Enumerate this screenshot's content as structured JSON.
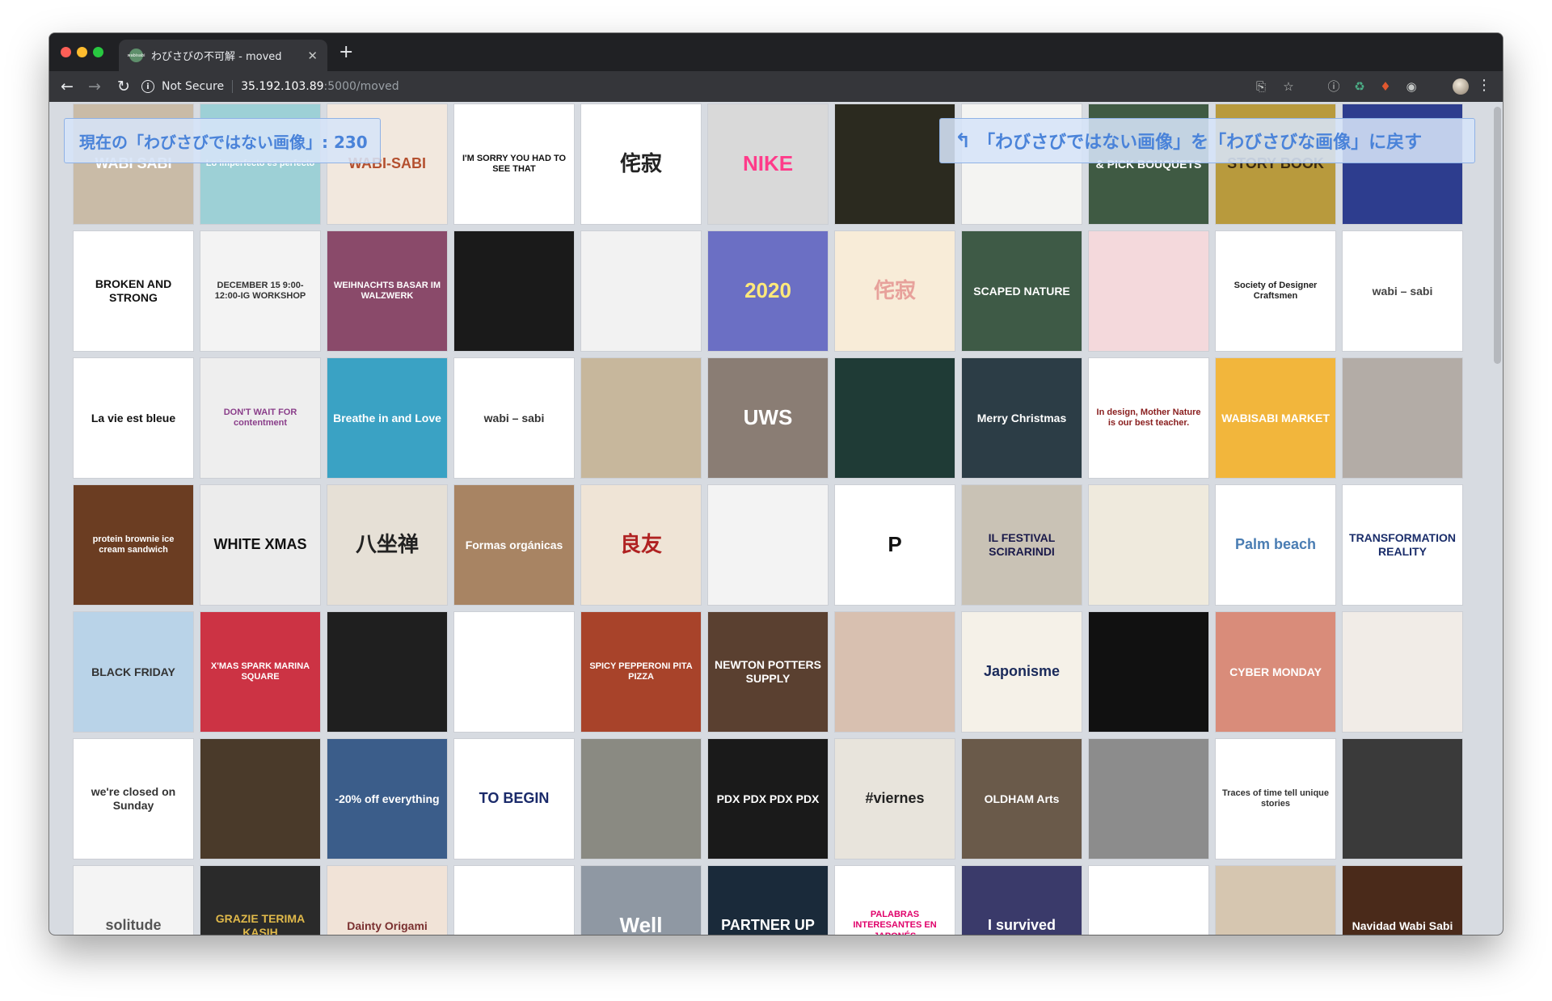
{
  "browser": {
    "tab_title": "わびさびの不可解 - moved",
    "tab_favicon_text": "wabisabi",
    "address": {
      "security": "Not Secure",
      "host": "35.192.103.89",
      "path": ":5000/moved"
    }
  },
  "page": {
    "count_label": "現在の「わびさびではない画像」: 230",
    "return_button_label": "「わびさびではない画像」を「わびさびな画像」に戻す"
  },
  "tiles": [
    [
      {
        "text": "WABI SABI",
        "bg": "#c9bba7",
        "fg": "#ffffff"
      },
      {
        "text": "Lo imperfecto es perfecto",
        "bg": "#9dd0d6",
        "fg": "#ffffff"
      },
      {
        "text": "WABI-SABI",
        "bg": "#f2e8de",
        "fg": "#b4502f"
      },
      {
        "text": "I'M SORRY YOU HAD TO SEE THAT",
        "bg": "#ffffff",
        "fg": "#111111"
      },
      {
        "text": "侘寂",
        "bg": "#ffffff",
        "fg": "#222222"
      },
      {
        "text": "NIKE",
        "bg": "#d9d9d9",
        "fg": "#ff3b8a"
      },
      {
        "text": "",
        "bg": "#2b2a1f",
        "fg": "#ffffff"
      },
      {
        "text": "",
        "bg": "#f4f4f2",
        "fg": "#555555"
      },
      {
        "text": "& PICK BOUQUETS",
        "bg": "#3f5a43",
        "fg": "#ffffff"
      },
      {
        "text": "STORY BOOK",
        "bg": "#b89a3d",
        "fg": "#3b2a0f"
      },
      {
        "text": "",
        "bg": "#2d3d8e",
        "fg": "#ffffff"
      }
    ],
    [
      {
        "text": "BROKEN AND STRONG",
        "bg": "#ffffff",
        "fg": "#111111"
      },
      {
        "text": "DECEMBER 15 9:00-12:00-IG WORKSHOP",
        "bg": "#f3f3f3",
        "fg": "#333333"
      },
      {
        "text": "WEIHNACHTS BASAR IM WALZWERK",
        "bg": "#8a4a6a",
        "fg": "#ffffff"
      },
      {
        "text": "",
        "bg": "#1a1a1a",
        "fg": "#cccccc"
      },
      {
        "text": "",
        "bg": "#f2f2f2",
        "fg": "#333333"
      },
      {
        "text": "2020",
        "bg": "#6b6fc4",
        "fg": "#ffe97a"
      },
      {
        "text": "侘寂",
        "bg": "#f8ecd8",
        "fg": "#e7a19b"
      },
      {
        "text": "SCAPED NATURE",
        "bg": "#3e5a46",
        "fg": "#ffffff"
      },
      {
        "text": "",
        "bg": "#f4d9dc",
        "fg": "#7a6a6a"
      },
      {
        "text": "Society of Designer Craftsmen",
        "bg": "#ffffff",
        "fg": "#222222"
      },
      {
        "text": "wabi – sabi",
        "bg": "#ffffff",
        "fg": "#444444"
      }
    ],
    [
      {
        "text": "La vie est bleue",
        "bg": "#ffffff",
        "fg": "#111111"
      },
      {
        "text": "DON'T WAIT FOR contentment",
        "bg": "#eeeeee",
        "fg": "#8a3e8a"
      },
      {
        "text": "Breathe in and Love",
        "bg": "#3aa2c4",
        "fg": "#ffffff"
      },
      {
        "text": "wabi – sabi",
        "bg": "#ffffff",
        "fg": "#333333"
      },
      {
        "text": "",
        "bg": "#c7b79c",
        "fg": "#333333"
      },
      {
        "text": "UWS",
        "bg": "#8a7d74",
        "fg": "#ffffff"
      },
      {
        "text": "",
        "bg": "#1f3b36",
        "fg": "#e8e8e8"
      },
      {
        "text": "Merry Christmas",
        "bg": "#2c3d46",
        "fg": "#ffffff"
      },
      {
        "text": "In design, Mother Nature is our best teacher.",
        "bg": "#ffffff",
        "fg": "#8a2020"
      },
      {
        "text": "WABISABI MARKET",
        "bg": "#f2b63c",
        "fg": "#ffffff"
      },
      {
        "text": "",
        "bg": "#b3aca6",
        "fg": "#ffffff"
      }
    ],
    [
      {
        "text": "protein brownie ice cream sandwich",
        "bg": "#6b3d22",
        "fg": "#ffffff"
      },
      {
        "text": "WHITE XMAS",
        "bg": "#ececec",
        "fg": "#111111"
      },
      {
        "text": "八坐禅",
        "bg": "#e6e0d6",
        "fg": "#222222"
      },
      {
        "text": "Formas orgánicas",
        "bg": "#a88463",
        "fg": "#ffffff"
      },
      {
        "text": "良友",
        "bg": "#efe4d6",
        "fg": "#b02222"
      },
      {
        "text": "",
        "bg": "#f3f3f3",
        "fg": "#555555"
      },
      {
        "text": "P",
        "bg": "#ffffff",
        "fg": "#111111"
      },
      {
        "text": "IL FESTIVAL SCIRARINDI",
        "bg": "#c9c2b5",
        "fg": "#1a1a4a"
      },
      {
        "text": "",
        "bg": "#efeadd",
        "fg": "#333333"
      },
      {
        "text": "Palm beach",
        "bg": "#ffffff",
        "fg": "#4a7db3"
      },
      {
        "text": "TRANSFORMATION REALITY",
        "bg": "#ffffff",
        "fg": "#1a2d6a"
      }
    ],
    [
      {
        "text": "BLACK FRIDAY",
        "bg": "#b9d3e8",
        "fg": "#333333"
      },
      {
        "text": "X'MAS SPARK MARINA SQUARE",
        "bg": "#cc3344",
        "fg": "#ffffff"
      },
      {
        "text": "",
        "bg": "#1f1f1f",
        "fg": "#eeeeee"
      },
      {
        "text": "",
        "bg": "#ffffff",
        "fg": "#222222"
      },
      {
        "text": "SPICY PEPPERONI PITA PIZZA",
        "bg": "#a8432a",
        "fg": "#ffffff"
      },
      {
        "text": "NEWTON POTTERS SUPPLY",
        "bg": "#5a4030",
        "fg": "#ffffff"
      },
      {
        "text": "",
        "bg": "#d8c0b0",
        "fg": "#222222"
      },
      {
        "text": "Japonisme",
        "bg": "#f5f1e8",
        "fg": "#1a2a5a"
      },
      {
        "text": "",
        "bg": "#111111",
        "fg": "#777777"
      },
      {
        "text": "CYBER MONDAY",
        "bg": "#d98c7a",
        "fg": "#ffffff"
      },
      {
        "text": "",
        "bg": "#f1ece7",
        "fg": "#777777"
      }
    ],
    [
      {
        "text": "we're closed on Sunday",
        "bg": "#ffffff",
        "fg": "#333333"
      },
      {
        "text": "",
        "bg": "#4a3a2a",
        "fg": "#ffffff"
      },
      {
        "text": "-20% off everything",
        "bg": "#3b5d8a",
        "fg": "#ffffff"
      },
      {
        "text": "TO BEGIN",
        "bg": "#ffffff",
        "fg": "#1a2a6a"
      },
      {
        "text": "",
        "bg": "#8a8a82",
        "fg": "#ffffff"
      },
      {
        "text": "PDX PDX PDX PDX",
        "bg": "#1a1a1a",
        "fg": "#ffffff"
      },
      {
        "text": "#viernes",
        "bg": "#e8e4dc",
        "fg": "#222222"
      },
      {
        "text": "OLDHAM Arts",
        "bg": "#6a5a4a",
        "fg": "#ffffff"
      },
      {
        "text": "",
        "bg": "#8c8c8c",
        "fg": "#ffffff"
      },
      {
        "text": "Traces of time tell unique stories",
        "bg": "#ffffff",
        "fg": "#333333"
      },
      {
        "text": "",
        "bg": "#3a3a3a",
        "fg": "#eeeeee"
      }
    ],
    [
      {
        "text": "solitude",
        "bg": "#f4f4f4",
        "fg": "#555555"
      },
      {
        "text": "GRAZIE TERIMA KASIH",
        "bg": "#2a2a2a",
        "fg": "#e0b94a"
      },
      {
        "text": "Dainty Origami",
        "bg": "#f1e3d7",
        "fg": "#7a3030"
      },
      {
        "text": "",
        "bg": "#ffffff",
        "fg": "#555555"
      },
      {
        "text": "Well",
        "bg": "#8f98a3",
        "fg": "#ffffff"
      },
      {
        "text": "PARTNER UP",
        "bg": "#1a2a3a",
        "fg": "#ffffff"
      },
      {
        "text": "PALABRAS INTERESANTES EN JAPONÉS",
        "bg": "#ffffff",
        "fg": "#e0006a"
      },
      {
        "text": "I survived",
        "bg": "#3a3a6a",
        "fg": "#ffffff"
      },
      {
        "text": "",
        "bg": "#ffffff",
        "fg": "#333333"
      },
      {
        "text": "",
        "bg": "#d6c6b0",
        "fg": "#222222"
      },
      {
        "text": "Navidad Wabi Sabi",
        "bg": "#4a2a1a",
        "fg": "#ffffff"
      }
    ]
  ]
}
